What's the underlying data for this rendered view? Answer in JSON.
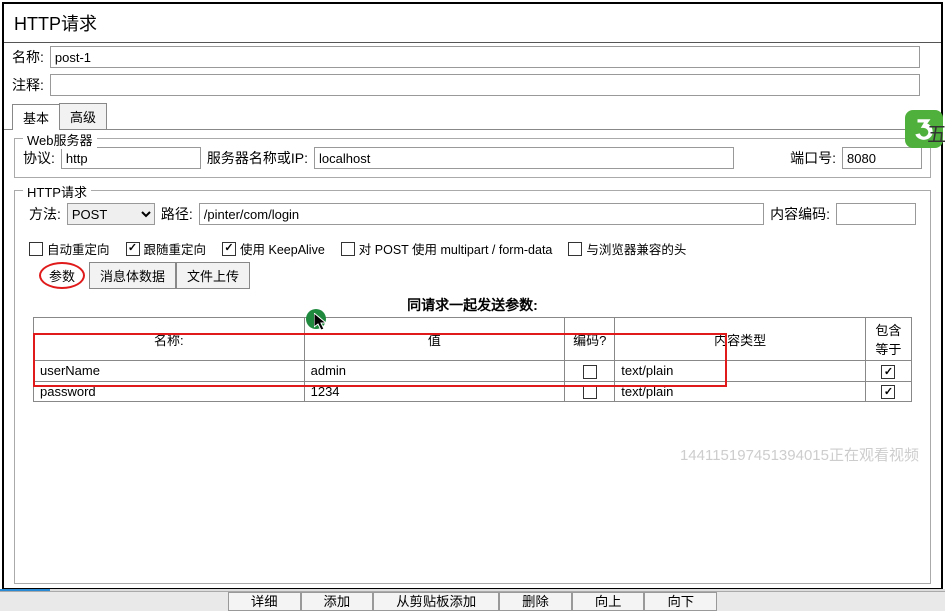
{
  "window_title": "HTTP请求",
  "name_label": "名称:",
  "name_value": "post-1",
  "remarks_label": "注释:",
  "remarks_value": "",
  "tabs": {
    "basic": "基本",
    "advanced": "高级"
  },
  "badge_text": "五",
  "webserver": {
    "legend": "Web服务器",
    "protocol_label": "协议:",
    "protocol_value": "http",
    "server_label": "服务器名称或IP:",
    "server_value": "localhost",
    "port_label": "端口号:",
    "port_value": "8080"
  },
  "http": {
    "legend": "HTTP请求",
    "method_label": "方法:",
    "method_value": "POST",
    "path_label": "路径:",
    "path_value": "/pinter/com/login",
    "encoding_label": "内容编码:",
    "encoding_value": ""
  },
  "checks": {
    "auto_redirect": "自动重定向",
    "follow_redirect": "跟随重定向",
    "keepalive": "使用 KeepAlive",
    "multipart": "对 POST 使用 multipart / form-data",
    "browser_headers": "与浏览器兼容的头"
  },
  "subtabs": {
    "params": "参数",
    "body": "消息体数据",
    "upload": "文件上传"
  },
  "send_params_title": "同请求一起发送参数:",
  "columns": {
    "name": "名称:",
    "value": "值",
    "encode": "编码?",
    "content_type": "内容类型",
    "include": "包含等于"
  },
  "rows": [
    {
      "name": "userName",
      "value": "admin",
      "encode": false,
      "content_type": "text/plain",
      "include": true
    },
    {
      "name": "password",
      "value": "1234",
      "encode": false,
      "content_type": "text/plain",
      "include": true
    }
  ],
  "watermark": "144115197451394015正在观看视频",
  "buttons": {
    "detail": "详细",
    "add": "添加",
    "clipboard": "从剪贴板添加",
    "delete": "删除",
    "up": "向上",
    "down": "向下"
  }
}
